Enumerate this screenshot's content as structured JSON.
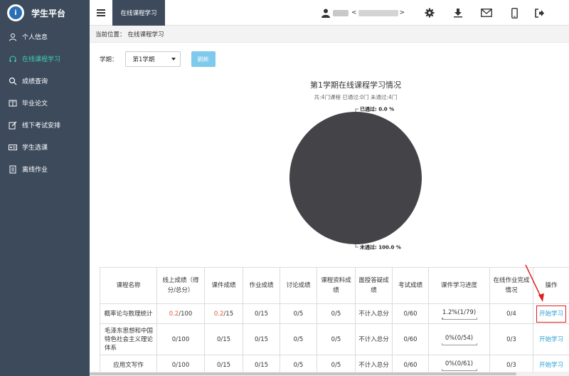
{
  "brand": {
    "logo_text": "i",
    "title": "学生平台"
  },
  "sidebar": {
    "items": [
      {
        "label": "个人信息",
        "icon": "user-icon",
        "active": false
      },
      {
        "label": "在线课程学习",
        "icon": "headset-icon",
        "active": true
      },
      {
        "label": "成绩查询",
        "icon": "search-icon",
        "active": false
      },
      {
        "label": "毕业论文",
        "icon": "book-icon",
        "active": false
      },
      {
        "label": "线下考试安排",
        "icon": "edit-icon",
        "active": false
      },
      {
        "label": "学生选课",
        "icon": "id-card-icon",
        "active": false
      },
      {
        "label": "离线作业",
        "icon": "document-icon",
        "active": false
      }
    ]
  },
  "topbar": {
    "tab_label": "在线课程学习",
    "user_left_bracket": "<",
    "user_right_bracket": ">",
    "icons": [
      "gear-icon",
      "download-icon",
      "mail-icon",
      "mobile-icon",
      "logout-icon"
    ]
  },
  "breadcrumb": {
    "prefix": "当前位置：",
    "current": "在线课程学习"
  },
  "filter": {
    "label": "学期：",
    "selected": "第1学期",
    "refresh_label": "刷新"
  },
  "chart_data": {
    "type": "pie",
    "title": "第1学期在线课程学习情况",
    "subtitle": "共:4门课程 已通过:0门 未通过:4门",
    "slices": [
      {
        "label": "已通过",
        "value": 0.0,
        "display": "已通过: 0.0 %",
        "color": "#3f93d9"
      },
      {
        "label": "未通过",
        "value": 100.0,
        "display": "未通过: 100.0 %",
        "color": "#434348"
      }
    ]
  },
  "table": {
    "headers": [
      "课程名称",
      "线上成绩（得分/总分）",
      "课件成绩",
      "作业成绩",
      "讨论成绩",
      "课程资料成绩",
      "面授答疑成绩",
      "考试成绩",
      "课件学习进度",
      "在线作业完成情况",
      "操作"
    ],
    "rows": [
      {
        "name": "概率论与数理统计",
        "online_score": "0.2",
        "online_total": "/100",
        "courseware_score": "0.2",
        "courseware_total": "/15",
        "homework": "0/15",
        "discussion": "0/5",
        "materials": "0/5",
        "faceqa": "不计入总分",
        "exam": "0/60",
        "progress_text": "1.2%(1/79)",
        "progress_value": 1.2,
        "online_homework": "0/4",
        "action": "开始学习"
      },
      {
        "name": "毛泽东思想和中国特色社会主义理论体系",
        "online_score": "0",
        "online_total": "/100",
        "courseware_score": "0",
        "courseware_total": "/15",
        "homework": "0/15",
        "discussion": "0/5",
        "materials": "0/5",
        "faceqa": "不计入总分",
        "exam": "0/60",
        "progress_text": "0%(0/54)",
        "progress_value": 0,
        "online_homework": "0/3",
        "action": "开始学习"
      },
      {
        "name": "应用文写作",
        "online_score": "0",
        "online_total": "/100",
        "courseware_score": "0",
        "courseware_total": "/15",
        "homework": "0/15",
        "discussion": "0/5",
        "materials": "0/5",
        "faceqa": "不计入总分",
        "exam": "0/60",
        "progress_text": "0%(0/61)",
        "progress_value": 0,
        "online_homework": "0/3",
        "action": "开始学习"
      }
    ]
  },
  "colors": {
    "sidebar_bg": "#3c4a5c",
    "active_item": "#3fd0b0",
    "link": "#2a9fd6",
    "highlight_box": "#e02020",
    "score_red": "#e05a3a"
  }
}
